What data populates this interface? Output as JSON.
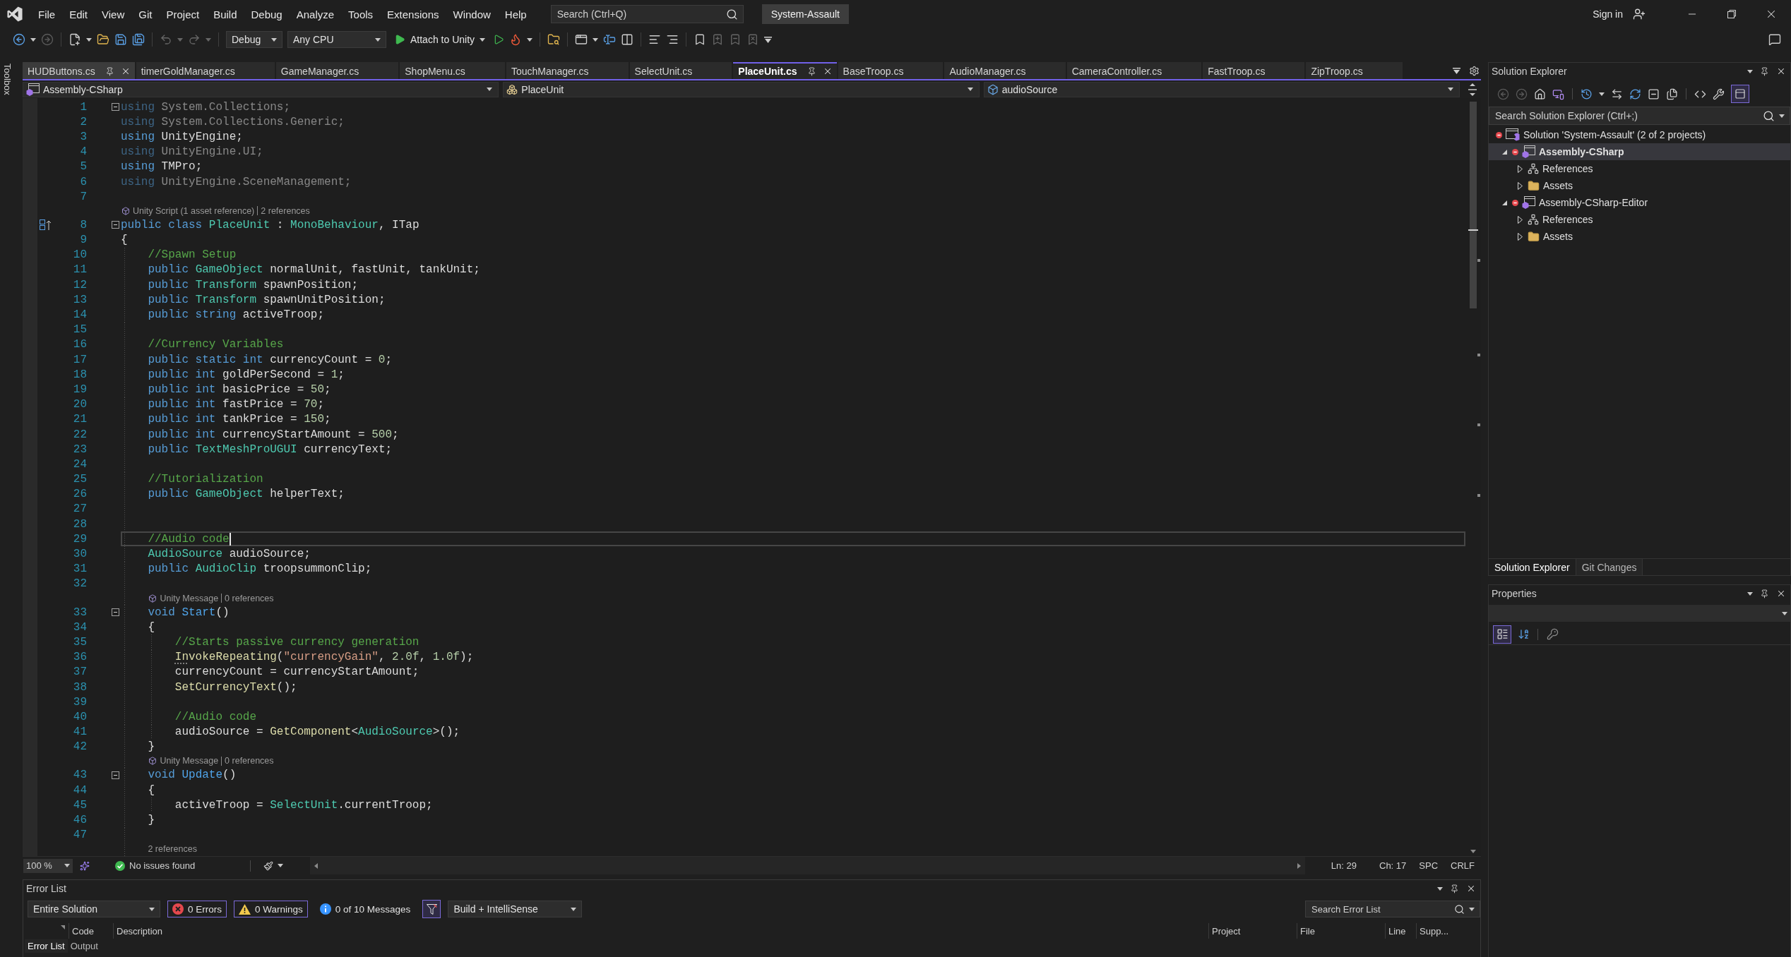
{
  "menu_bar": {
    "items": [
      "File",
      "Edit",
      "View",
      "Git",
      "Project",
      "Build",
      "Debug",
      "Analyze",
      "Tools",
      "Extensions",
      "Window",
      "Help"
    ],
    "search": {
      "placeholder": "Search (Ctrl+Q)"
    },
    "solution_name": "System-Assault",
    "sign_in": "Sign in"
  },
  "toolbar": {
    "configuration": "Debug",
    "platform": "Any CPU",
    "start_button": "Attach to Unity"
  },
  "toolbox": {
    "label": "Toolbox"
  },
  "document_tabs": [
    {
      "label": "HUDButtons.cs",
      "selected": false,
      "hovered": true
    },
    {
      "label": "timerGoldManager.cs",
      "selected": false,
      "hovered": false
    },
    {
      "label": "GameManager.cs",
      "selected": false,
      "hovered": false
    },
    {
      "label": "ShopMenu.cs",
      "selected": false,
      "hovered": false
    },
    {
      "label": "TouchManager.cs",
      "selected": false,
      "hovered": false
    },
    {
      "label": "SelectUnit.cs",
      "selected": false,
      "hovered": false
    },
    {
      "label": "PlaceUnit.cs",
      "selected": true,
      "hovered": false
    },
    {
      "label": "BaseTroop.cs",
      "selected": false,
      "hovered": false
    },
    {
      "label": "AudioManager.cs",
      "selected": false,
      "hovered": false
    },
    {
      "label": "CameraController.cs",
      "selected": false,
      "hovered": false
    },
    {
      "label": "FastTroop.cs",
      "selected": false,
      "hovered": false
    },
    {
      "label": "ZipTroop.cs",
      "selected": false,
      "hovered": false
    }
  ],
  "navigation_bar": [
    {
      "kind": "project",
      "label": "Assembly-CSharp"
    },
    {
      "kind": "class",
      "label": "PlaceUnit"
    },
    {
      "kind": "field",
      "label": "audioSource"
    }
  ],
  "editor": {
    "rows": [
      {
        "kind": "code",
        "number": "1",
        "expanded": true,
        "faded": true,
        "tokens": [
          {
            "text": "using",
            "kind": "keyword"
          },
          {
            "text": " System.Collections;",
            "kind": "plain"
          }
        ]
      },
      {
        "kind": "code",
        "number": "2",
        "faded": true,
        "tokens": [
          {
            "text": "using",
            "kind": "keyword"
          },
          {
            "text": " System.Collections.Generic;",
            "kind": "plain"
          }
        ]
      },
      {
        "kind": "code",
        "number": "3",
        "faded": false,
        "tokens": [
          {
            "text": "using",
            "kind": "keyword"
          },
          {
            "text": " UnityEngine;",
            "kind": "plain"
          }
        ]
      },
      {
        "kind": "code",
        "number": "4",
        "faded": true,
        "tokens": [
          {
            "text": "using",
            "kind": "keyword"
          },
          {
            "text": " UnityEngine.UI;",
            "kind": "plain"
          }
        ]
      },
      {
        "kind": "code",
        "number": "5",
        "faded": false,
        "tokens": [
          {
            "text": "using",
            "kind": "keyword"
          },
          {
            "text": " TMPro;",
            "kind": "plain"
          }
        ]
      },
      {
        "kind": "code",
        "number": "6",
        "faded": true,
        "tokens": [
          {
            "text": "using",
            "kind": "keyword"
          },
          {
            "text": " UnityEngine.SceneManagement;",
            "kind": "plain"
          }
        ]
      },
      {
        "kind": "code",
        "number": "7"
      },
      {
        "kind": "lens",
        "icon": true,
        "parts": [
          "Unity Script (1 asset reference)",
          "2 references"
        ]
      },
      {
        "kind": "code",
        "number": "8",
        "expanded": true,
        "margin_glyph": true,
        "tokens": [
          {
            "text": "public class ",
            "kind": "keyword"
          },
          {
            "text": "PlaceUnit",
            "kind": "type"
          },
          {
            "text": " : ",
            "kind": "plain"
          },
          {
            "text": "MonoBehaviour",
            "kind": "type"
          },
          {
            "text": ", ITap",
            "kind": "plain"
          }
        ]
      },
      {
        "kind": "code",
        "number": "9",
        "tokens": [
          {
            "text": "{",
            "kind": "plain"
          }
        ],
        "children": [
          {
            "kind": "code",
            "number": "10",
            "tokens": [
              {
                "text": "//Spawn Setup",
                "kind": "comment"
              }
            ]
          },
          {
            "kind": "code",
            "number": "11",
            "tokens": [
              {
                "text": "public ",
                "kind": "keyword"
              },
              {
                "text": "GameObject",
                "kind": "type"
              },
              {
                "text": " normalUnit, fastUnit, tankUnit;",
                "kind": "plain"
              }
            ]
          },
          {
            "kind": "code",
            "number": "12",
            "tokens": [
              {
                "text": "public ",
                "kind": "keyword"
              },
              {
                "text": "Transform",
                "kind": "type"
              },
              {
                "text": " spawnPosition;",
                "kind": "plain"
              }
            ]
          },
          {
            "kind": "code",
            "number": "13",
            "tokens": [
              {
                "text": "public ",
                "kind": "keyword"
              },
              {
                "text": "Transform",
                "kind": "type"
              },
              {
                "text": " spawnUnitPosition;",
                "kind": "plain"
              }
            ]
          },
          {
            "kind": "code",
            "number": "14",
            "tokens": [
              {
                "text": "public string ",
                "kind": "keyword"
              },
              {
                "text": "activeTroop;",
                "kind": "plain"
              }
            ]
          },
          {
            "kind": "code",
            "number": "15"
          },
          {
            "kind": "code",
            "number": "16",
            "tokens": [
              {
                "text": "//Currency Variables",
                "kind": "comment"
              }
            ]
          },
          {
            "kind": "code",
            "number": "17",
            "tokens": [
              {
                "text": "public static int ",
                "kind": "keyword"
              },
              {
                "text": "currencyCount = ",
                "kind": "plain"
              },
              {
                "text": "0",
                "kind": "number"
              },
              {
                "text": ";",
                "kind": "plain"
              }
            ]
          },
          {
            "kind": "code",
            "number": "18",
            "tokens": [
              {
                "text": "public int ",
                "kind": "keyword"
              },
              {
                "text": "goldPerSecond = ",
                "kind": "plain"
              },
              {
                "text": "1",
                "kind": "number"
              },
              {
                "text": ";",
                "kind": "plain"
              }
            ]
          },
          {
            "kind": "code",
            "number": "19",
            "tokens": [
              {
                "text": "public int ",
                "kind": "keyword"
              },
              {
                "text": "basicPrice = ",
                "kind": "plain"
              },
              {
                "text": "50",
                "kind": "number"
              },
              {
                "text": ";",
                "kind": "plain"
              }
            ]
          },
          {
            "kind": "code",
            "number": "20",
            "tokens": [
              {
                "text": "public int ",
                "kind": "keyword"
              },
              {
                "text": "fastPrice = ",
                "kind": "plain"
              },
              {
                "text": "70",
                "kind": "number"
              },
              {
                "text": ";",
                "kind": "plain"
              }
            ]
          },
          {
            "kind": "code",
            "number": "21",
            "tokens": [
              {
                "text": "public int ",
                "kind": "keyword"
              },
              {
                "text": "tankPrice = ",
                "kind": "plain"
              },
              {
                "text": "150",
                "kind": "number"
              },
              {
                "text": ";",
                "kind": "plain"
              }
            ]
          },
          {
            "kind": "code",
            "number": "22",
            "tokens": [
              {
                "text": "public int ",
                "kind": "keyword"
              },
              {
                "text": "currencyStartAmount = ",
                "kind": "plain"
              },
              {
                "text": "500",
                "kind": "number"
              },
              {
                "text": ";",
                "kind": "plain"
              }
            ]
          },
          {
            "kind": "code",
            "number": "23",
            "tokens": [
              {
                "text": "public ",
                "kind": "keyword"
              },
              {
                "text": "TextMeshProUGUI",
                "kind": "type"
              },
              {
                "text": " currencyText;",
                "kind": "plain"
              }
            ]
          },
          {
            "kind": "code",
            "number": "24"
          },
          {
            "kind": "code",
            "number": "25",
            "tokens": [
              {
                "text": "//Tutorialization",
                "kind": "comment"
              }
            ]
          },
          {
            "kind": "code",
            "number": "26",
            "tokens": [
              {
                "text": "public ",
                "kind": "keyword"
              },
              {
                "text": "GameObject",
                "kind": "type"
              },
              {
                "text": " helperText;",
                "kind": "plain"
              }
            ]
          },
          {
            "kind": "code",
            "number": "27"
          },
          {
            "kind": "code",
            "number": "28"
          },
          {
            "kind": "code",
            "number": "29",
            "current": true,
            "tokens": [
              {
                "text": "//Audio code",
                "kind": "comment"
              }
            ]
          },
          {
            "kind": "code",
            "number": "30",
            "tokens": [
              {
                "text": "AudioSource",
                "kind": "type"
              },
              {
                "text": " audioSource;",
                "kind": "plain"
              }
            ]
          },
          {
            "kind": "code",
            "number": "31",
            "tokens": [
              {
                "text": "public ",
                "kind": "keyword"
              },
              {
                "text": "AudioClip",
                "kind": "type"
              },
              {
                "text": " troopsummonClip;",
                "kind": "plain"
              }
            ]
          },
          {
            "kind": "code",
            "number": "32"
          },
          {
            "kind": "lens",
            "icon": true,
            "parts": [
              "Unity Message",
              "0 references"
            ]
          },
          {
            "kind": "code",
            "number": "33",
            "expanded": true,
            "tokens": [
              {
                "text": "void ",
                "kind": "keyword"
              },
              {
                "text": "Start",
                "kind": "message"
              },
              {
                "text": "()",
                "kind": "plain"
              }
            ]
          },
          {
            "kind": "code",
            "number": "34",
            "tokens": [
              {
                "text": "{",
                "kind": "plain"
              }
            ],
            "children": [
              {
                "kind": "code",
                "number": "35",
                "tokens": [
                  {
                    "text": "//Starts passive currency generation",
                    "kind": "comment"
                  }
                ]
              },
              {
                "kind": "code",
                "number": "36",
                "tokens": [
                  {
                    "text": "In",
                    "kind": "method",
                    "hint": true
                  },
                  {
                    "text": "vokeRepeating",
                    "kind": "method"
                  },
                  {
                    "text": "(",
                    "kind": "plain"
                  },
                  {
                    "text": "\"currencyGain\"",
                    "kind": "string"
                  },
                  {
                    "text": ", ",
                    "kind": "plain"
                  },
                  {
                    "text": "2.0f",
                    "kind": "number"
                  },
                  {
                    "text": ", ",
                    "kind": "plain"
                  },
                  {
                    "text": "1.0f",
                    "kind": "number"
                  },
                  {
                    "text": ");",
                    "kind": "plain"
                  }
                ]
              },
              {
                "kind": "code",
                "number": "37",
                "tokens": [
                  {
                    "text": "currencyCount = currencyStartAmount;",
                    "kind": "plain"
                  }
                ]
              },
              {
                "kind": "code",
                "number": "38",
                "tokens": [
                  {
                    "text": "SetCurrencyText",
                    "kind": "method"
                  },
                  {
                    "text": "();",
                    "kind": "plain"
                  }
                ]
              },
              {
                "kind": "code",
                "number": "39"
              },
              {
                "kind": "code",
                "number": "40",
                "tokens": [
                  {
                    "text": "//Audio code",
                    "kind": "comment"
                  }
                ]
              },
              {
                "kind": "code",
                "number": "41",
                "tokens": [
                  {
                    "text": "audioSource = ",
                    "kind": "plain"
                  },
                  {
                    "text": "GetComponent",
                    "kind": "method"
                  },
                  {
                    "text": "<",
                    "kind": "plain"
                  },
                  {
                    "text": "AudioSource",
                    "kind": "type"
                  },
                  {
                    "text": ">();",
                    "kind": "plain"
                  }
                ]
              }
            ]
          },
          {
            "kind": "code",
            "number": "42",
            "tokens": [
              {
                "text": "}",
                "kind": "plain"
              }
            ]
          },
          {
            "kind": "lens",
            "icon": true,
            "parts": [
              "Unity Message",
              "0 references"
            ]
          },
          {
            "kind": "code",
            "number": "43",
            "expanded": true,
            "tokens": [
              {
                "text": "void ",
                "kind": "keyword"
              },
              {
                "text": "Update",
                "kind": "message"
              },
              {
                "text": "()",
                "kind": "plain"
              }
            ]
          },
          {
            "kind": "code",
            "number": "44",
            "tokens": [
              {
                "text": "{",
                "kind": "plain"
              }
            ],
            "children": [
              {
                "kind": "code",
                "number": "45",
                "tokens": [
                  {
                    "text": "activeTroop = ",
                    "kind": "plain"
                  },
                  {
                    "text": "SelectUnit",
                    "kind": "type"
                  },
                  {
                    "text": ".currentTroop;",
                    "kind": "plain"
                  }
                ]
              }
            ]
          },
          {
            "kind": "code",
            "number": "46",
            "tokens": [
              {
                "text": "}",
                "kind": "plain"
              }
            ]
          },
          {
            "kind": "code",
            "number": "47"
          },
          {
            "kind": "lens",
            "icon": false,
            "parts": [
              "2 references"
            ]
          }
        ]
      }
    ]
  },
  "editor_status": {
    "zoom": "100 %",
    "issues": "No issues found",
    "line": "Ln: 29",
    "column": "Ch: 17",
    "whitespace": "SPC",
    "line_endings": "CRLF"
  },
  "error_list": {
    "title": "Error List",
    "scope": "Entire Solution",
    "filters": [
      {
        "kind": "error",
        "label": "0 Errors",
        "on": true
      },
      {
        "kind": "warning",
        "label": "0 Warnings",
        "on": true
      },
      {
        "kind": "message",
        "label": "0 of 10 Messages",
        "on": false
      }
    ],
    "document_filter": {
      "on": true
    },
    "source": "Build + IntelliSense",
    "search": {
      "placeholder": "Search Error List"
    },
    "columns": [
      "Code",
      "Description",
      "Project",
      "File",
      "Line",
      "Supp..."
    ]
  },
  "bottom_tabs": [
    {
      "label": "Error List",
      "selected": true
    },
    {
      "label": "Output",
      "selected": false
    }
  ],
  "solution_explorer": {
    "title": "Solution Explorer",
    "preview_toggle": {
      "on": true
    },
    "search": {
      "placeholder": "Search Solution Explorer (Ctrl+;)"
    },
    "tree": [
      {
        "kind": "solution",
        "label": "Solution 'System-Assault' (2 of 2 projects)",
        "selected": false,
        "children": [
          {
            "kind": "project",
            "label": "Assembly-CSharp",
            "selected": true,
            "startup": true,
            "expanded": true,
            "children": [
              {
                "kind": "references",
                "label": "References",
                "selected": false,
                "expanded": false
              },
              {
                "kind": "folder",
                "label": "Assets",
                "selected": false,
                "expanded": false
              }
            ]
          },
          {
            "kind": "project",
            "label": "Assembly-CSharp-Editor",
            "selected": false,
            "startup": false,
            "expanded": true,
            "children": [
              {
                "kind": "references",
                "label": "References",
                "selected": false,
                "expanded": false
              },
              {
                "kind": "folder",
                "label": "Assets",
                "selected": false,
                "expanded": false
              }
            ]
          }
        ]
      }
    ],
    "tabs": [
      {
        "label": "Solution Explorer",
        "selected": true
      },
      {
        "label": "Git Changes",
        "selected": false
      }
    ]
  },
  "properties": {
    "title": "Properties",
    "view_buttons": [
      {
        "kind": "categorized",
        "selected": true
      },
      {
        "kind": "alphabetical",
        "selected": false
      },
      {
        "kind": "property_pages",
        "selected": false
      }
    ]
  }
}
